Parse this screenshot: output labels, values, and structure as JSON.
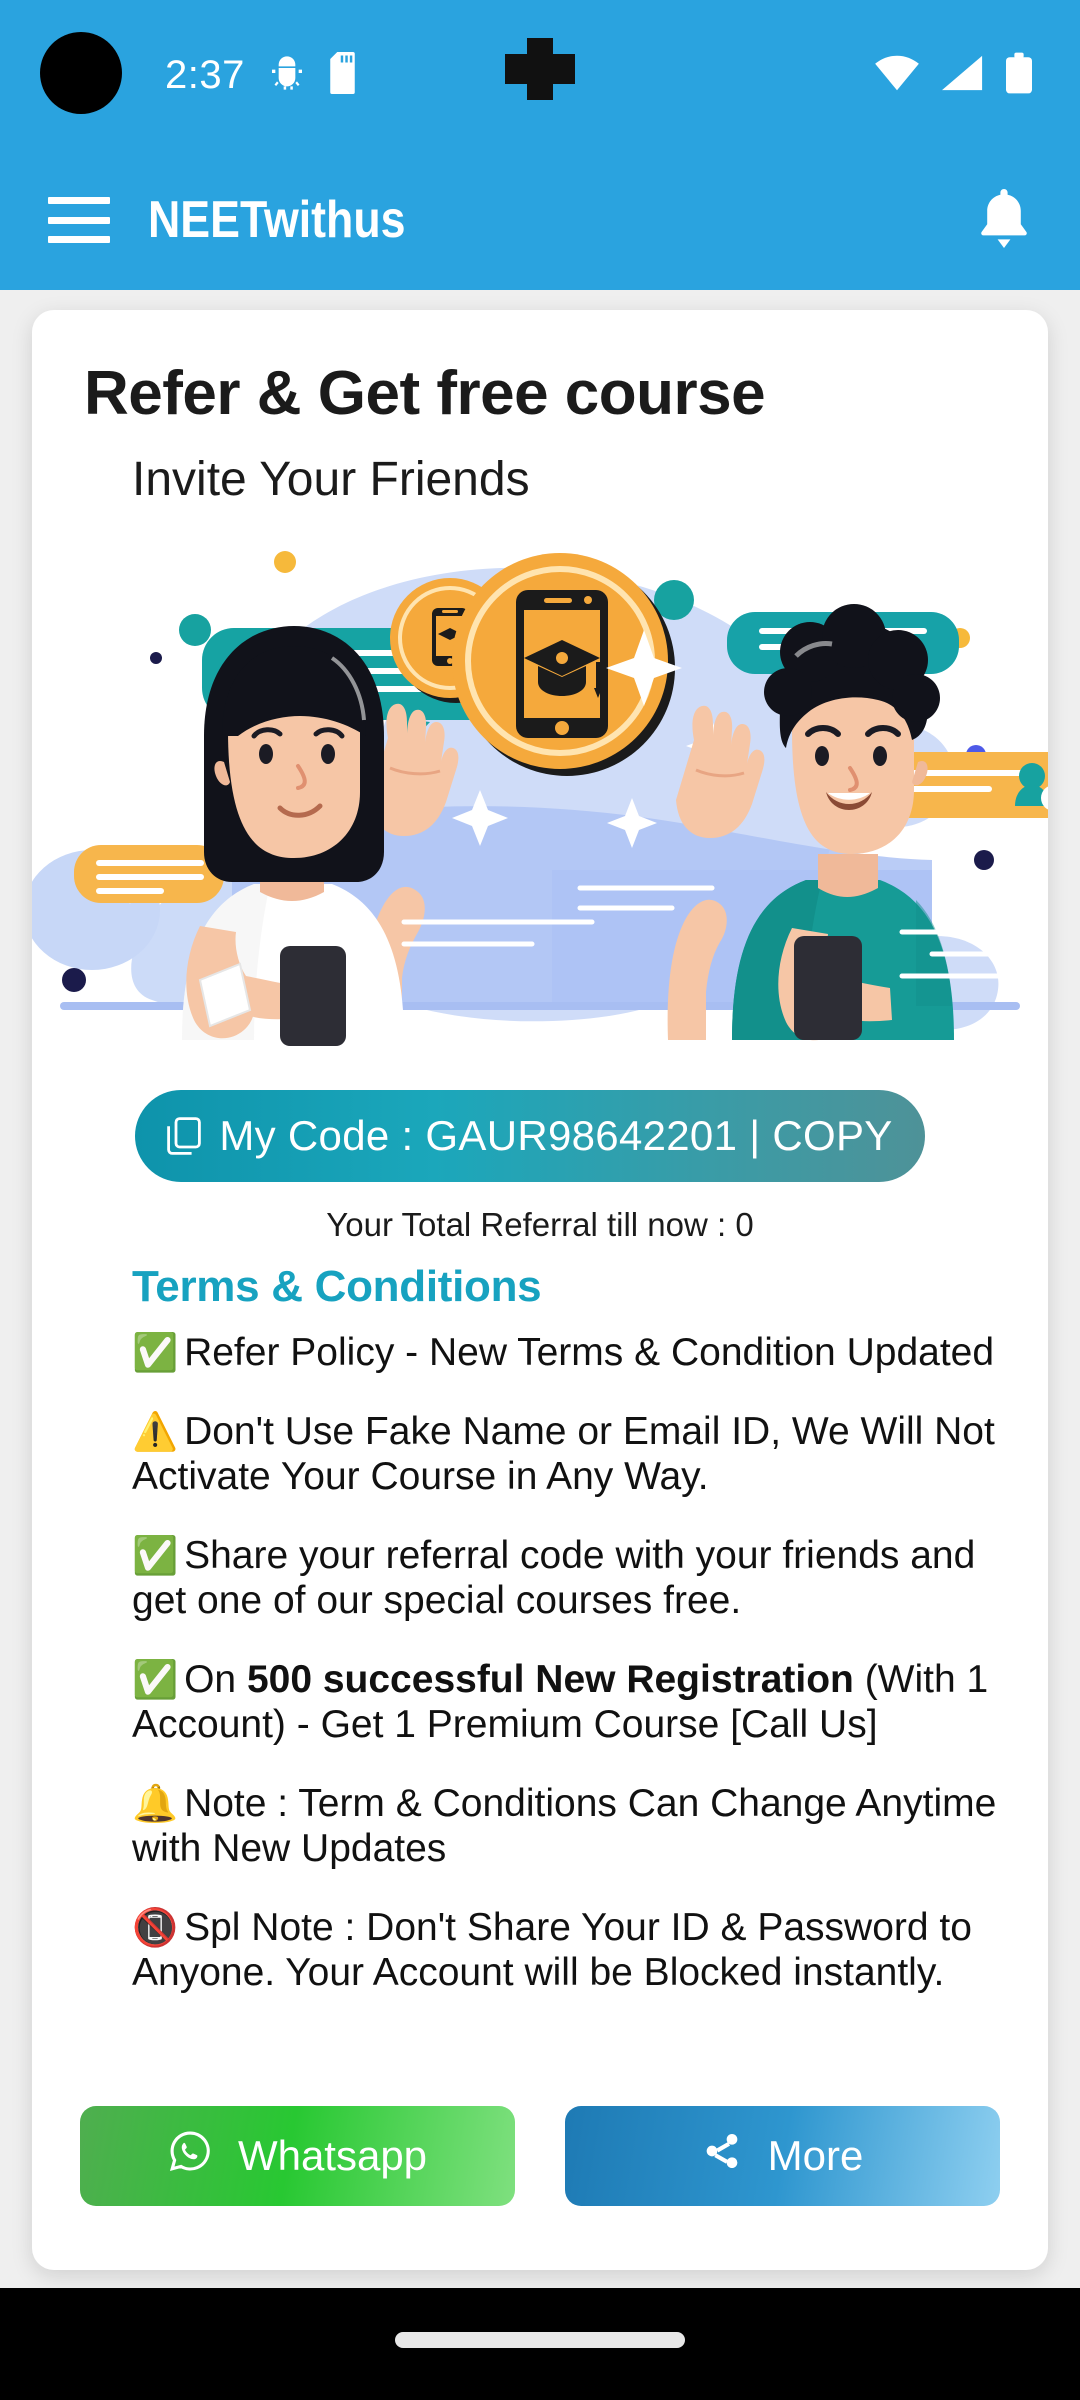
{
  "status_bar": {
    "time": "2:37",
    "icons": [
      "android-debug-icon",
      "sd-card-icon",
      "wifi-icon",
      "cellular-signal-icon",
      "battery-icon"
    ]
  },
  "app_bar": {
    "menu_icon": "hamburger-menu-icon",
    "title": "NEETwithus",
    "notification_icon": "bell-icon"
  },
  "card": {
    "title": "Refer & Get free course",
    "subtitle": "Invite Your Friends",
    "illustration": "referral-friends-illustration"
  },
  "code_button": {
    "icon": "copy-icon",
    "label": "My Code : GAUR98642201  |  COPY",
    "code": "GAUR98642201",
    "action": "COPY"
  },
  "referral_count_text": "Your Total Referral till now : 0",
  "terms": {
    "heading": "Terms & Conditions",
    "items": [
      {
        "emoji": "✅",
        "text": "Refer Policy - New Terms & Condition Updated"
      },
      {
        "emoji": "⚠️",
        "text": "Don't Use Fake Name or Email ID, We Will Not Activate Your Course in Any Way."
      },
      {
        "emoji": "✅",
        "text": "Share your referral code with your friends and get one of our special courses free."
      },
      {
        "emoji": "✅",
        "text_before": "On ",
        "bold": "500 successful New Registration",
        "text_after": " (With 1 Account) - Get 1 Premium Course [Call Us]"
      },
      {
        "emoji": "🔔",
        "text": "Note : Term & Conditions Can Change Anytime with New Updates"
      },
      {
        "emoji": "📵",
        "text": "Spl Note : Don't Share Your ID & Password to Anyone. Your Account will be Blocked instantly."
      }
    ]
  },
  "share": {
    "whatsapp_label": "Whatsapp",
    "whatsapp_icon": "whatsapp-icon",
    "more_label": "More",
    "more_icon": "share-icon"
  },
  "colors": {
    "app_bar_blue": "#2AA3DF",
    "terms_heading_teal": "#17A2C0",
    "whatsapp_green": "#28C832",
    "more_blue": "#2E96CF",
    "code_button_teal": "#1BA7BB"
  }
}
